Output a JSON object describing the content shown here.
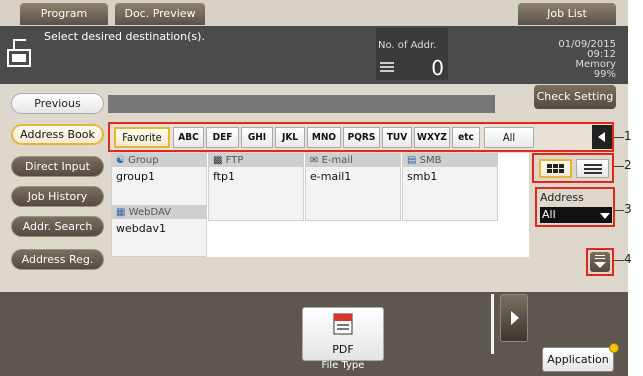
{
  "tabs": {
    "program": "Program",
    "doc_preview": "Doc. Preview",
    "job_list": "Job List"
  },
  "status": {
    "message": "Select desired destination(s).",
    "addr_label": "No. of Addr.",
    "addr_count": "0",
    "date": "01/09/2015",
    "time": "09:12",
    "memory_label": "Memory",
    "memory_value": "99%"
  },
  "buttons": {
    "previous": "Previous",
    "check_setting": "Check Setting",
    "application": "Application"
  },
  "sidebar": [
    {
      "label": "Address Book"
    },
    {
      "label": "Direct Input"
    },
    {
      "label": "Job History"
    },
    {
      "label": "Addr. Search"
    },
    {
      "label": "Address Reg."
    }
  ],
  "index_tabs": [
    "Favorite",
    "ABC",
    "DEF",
    "GHI",
    "JKL",
    "MNO",
    "PQRS",
    "TUV",
    "WXYZ",
    "etc",
    "All"
  ],
  "destinations": [
    {
      "type": "Group",
      "name": "group1",
      "icon": "group-icon"
    },
    {
      "type": "FTP",
      "name": "ftp1",
      "icon": "ftp-icon"
    },
    {
      "type": "E-mail",
      "name": "e-mail1",
      "icon": "email-icon"
    },
    {
      "type": "SMB",
      "name": "smb1",
      "icon": "smb-icon"
    },
    {
      "type": "WebDAV",
      "name": "webdav1",
      "icon": "webdav-icon"
    }
  ],
  "address_filter": {
    "label": "Address",
    "value": "All"
  },
  "file_type": {
    "value": "PDF",
    "label": "File Type"
  },
  "callouts": [
    "1",
    "2",
    "3",
    "4"
  ],
  "colors": {
    "highlight": "#e3271b",
    "active_border": "#e8b43a",
    "status_bg": "#4b4b4b",
    "panel_bg": "#ded8cc"
  }
}
